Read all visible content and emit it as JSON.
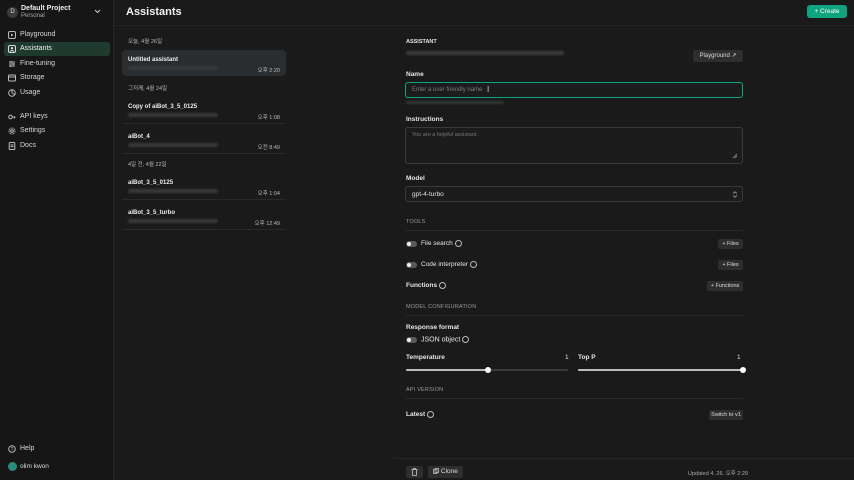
{
  "sidebar": {
    "project_initial": "D",
    "project_name": "Default Project",
    "project_sub": "Personal",
    "items": [
      {
        "label": "Playground",
        "icon": "playground-icon"
      },
      {
        "label": "Assistants",
        "icon": "assistants-icon"
      },
      {
        "label": "Fine-tuning",
        "icon": "fine-tuning-icon"
      },
      {
        "label": "Storage",
        "icon": "storage-icon"
      },
      {
        "label": "Usage",
        "icon": "usage-icon"
      },
      {
        "label": "API keys",
        "icon": "key-icon"
      },
      {
        "label": "Settings",
        "icon": "gear-icon"
      },
      {
        "label": "Docs",
        "icon": "docs-icon"
      }
    ],
    "help_label": "Help",
    "user_name": "olim kwon"
  },
  "header": {
    "title": "Assistants",
    "create_label": "+ Create"
  },
  "list": {
    "groups": [
      {
        "date": "오늘, 4월 26일",
        "items": [
          {
            "name": "Untitled assistant",
            "time": "오후 2:20"
          }
        ]
      },
      {
        "date": "그저께, 4월 24일",
        "items": [
          {
            "name": "Copy of aiBot_3_5_0125",
            "time": "오후 1:08"
          },
          {
            "name": "aiBot_4",
            "time": "오전 8:49"
          }
        ]
      },
      {
        "date": "4일 전, 4월 22일",
        "items": [
          {
            "name": "aiBot_3_5_0125",
            "time": "오후 1:04"
          },
          {
            "name": "aiBot_3_5_turbo",
            "time": "오후 12:49"
          }
        ]
      }
    ]
  },
  "detail": {
    "section_label": "ASSISTANT",
    "playground_label": "Playground ↗",
    "name_label": "Name",
    "name_placeholder": "Enter a user friendly name",
    "instructions_label": "Instructions",
    "instructions_placeholder": "You are a helpful assistant.",
    "model_label": "Model",
    "model_value": "gpt-4-turbo",
    "tools_label": "TOOLS",
    "file_search_label": "File search",
    "files_btn_1": "+ Files",
    "code_interpreter_label": "Code interpreter",
    "files_btn_2": "+ Files",
    "functions_label": "Functions",
    "functions_btn": "+ Functions",
    "model_config_label": "MODEL CONFIGURATION",
    "response_format_label": "Response format",
    "json_object_label": "JSON object",
    "temperature_label": "Temperature",
    "temperature_value": "1",
    "temperature_level": 1,
    "top_p_label": "Top P",
    "top_p_value": "1",
    "top_p_level": 1,
    "api_version_label": "API VERSION",
    "latest_label": "Latest",
    "switch_label": "Switch to v1",
    "clone_label": "Clone",
    "updated_label": "Updated 4. 26. 오후 2:29"
  },
  "colors": {
    "accent": "#10a37f",
    "active_nav_bg": "#1f3b2f",
    "background": "#1a1a1a"
  }
}
